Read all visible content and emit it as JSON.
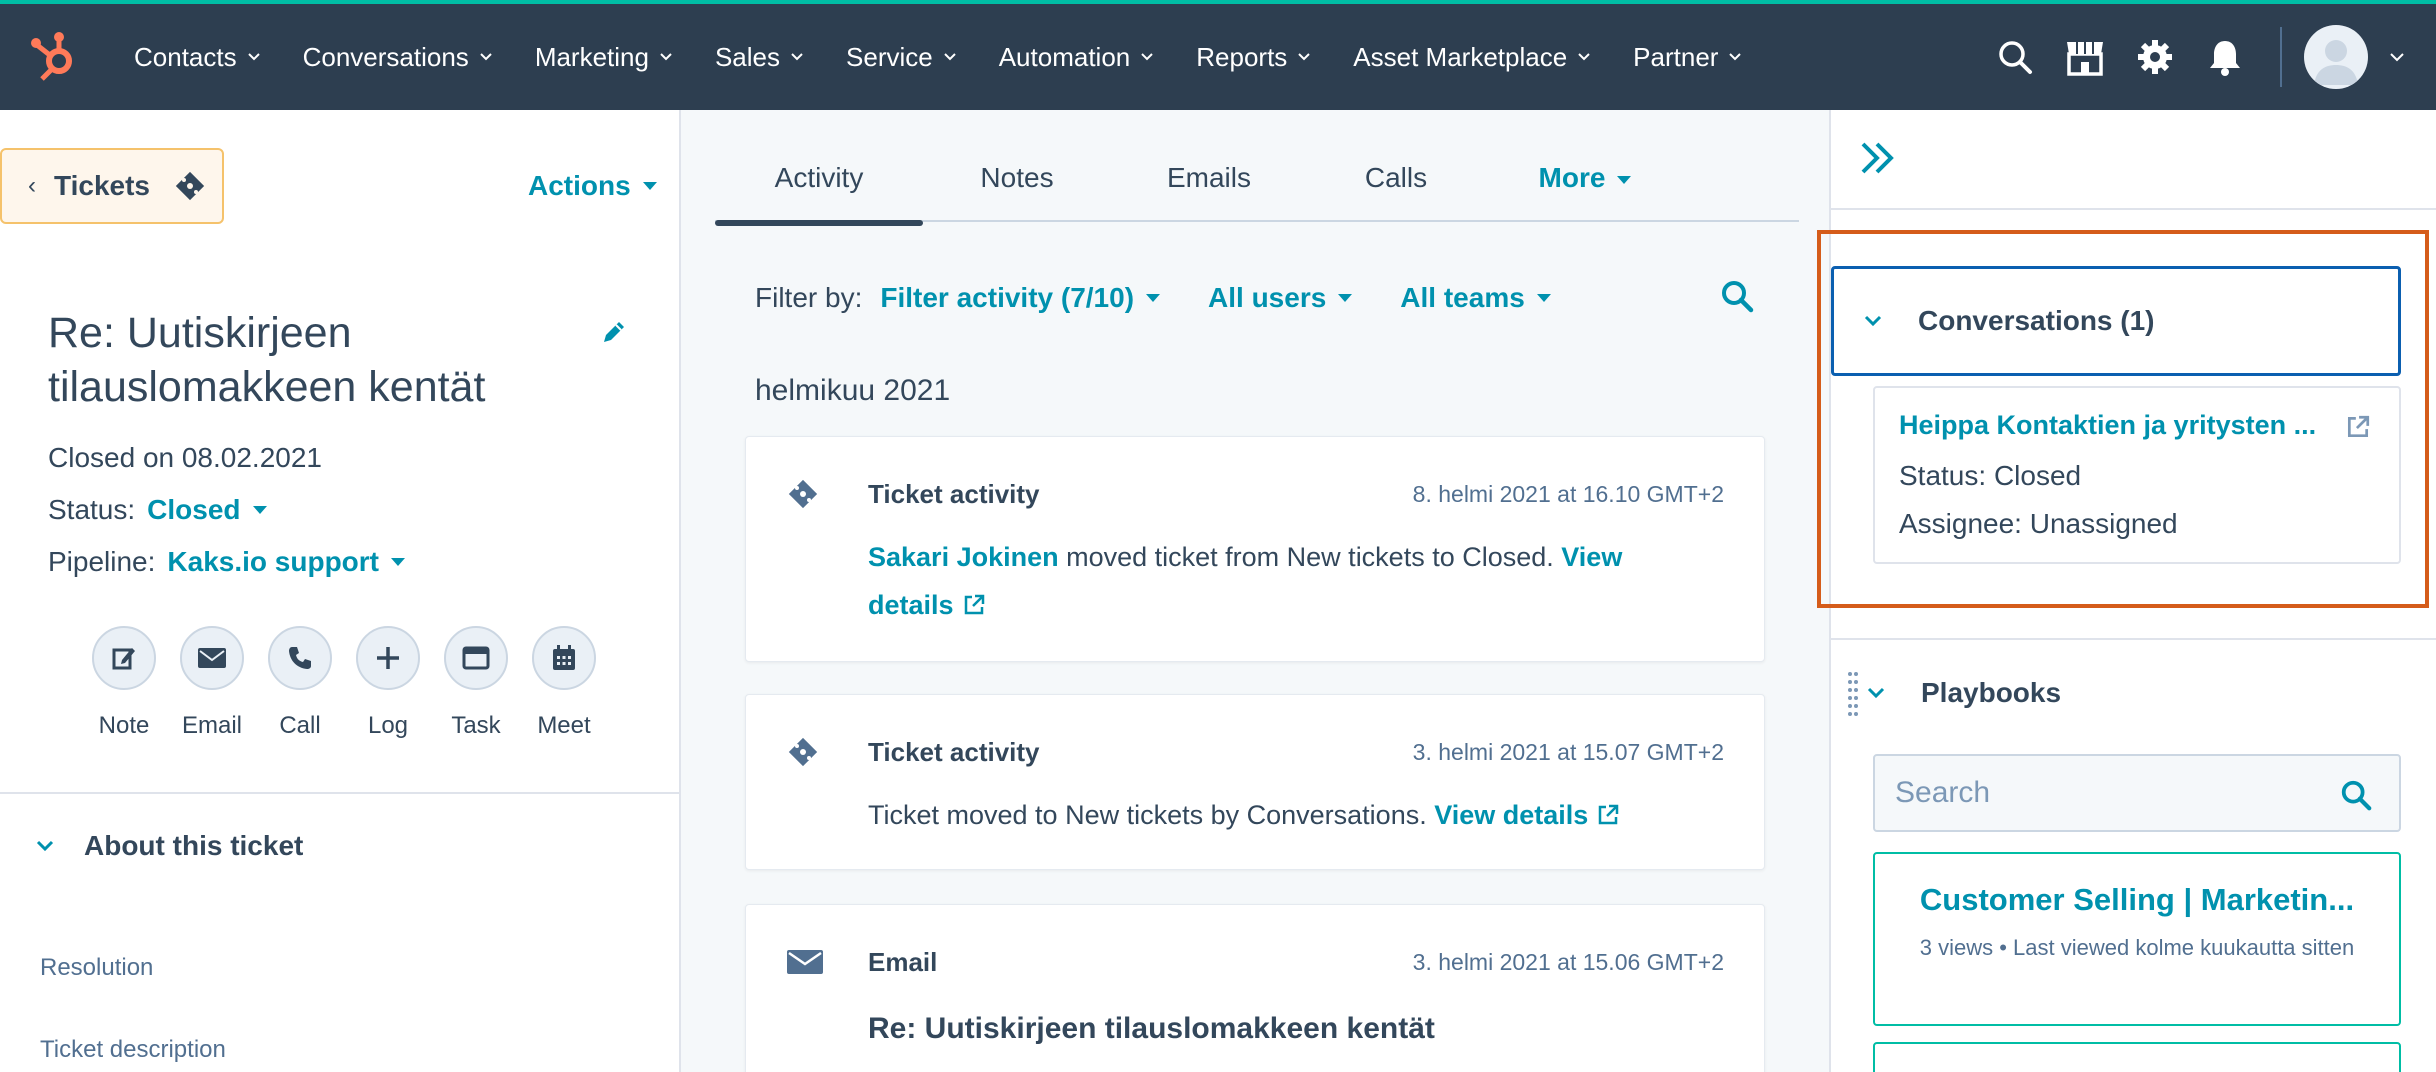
{
  "nav": {
    "items": [
      {
        "label": "Contacts"
      },
      {
        "label": "Conversations"
      },
      {
        "label": "Marketing"
      },
      {
        "label": "Sales"
      },
      {
        "label": "Service"
      },
      {
        "label": "Automation"
      },
      {
        "label": "Reports"
      },
      {
        "label": "Asset Marketplace"
      },
      {
        "label": "Partner"
      }
    ],
    "icons": [
      "search-icon",
      "marketplace-icon",
      "settings-gear-icon",
      "notifications-bell-icon",
      "avatar"
    ]
  },
  "left": {
    "back_label": "Tickets",
    "actions_label": "Actions",
    "title": "Re: Uutiskirjeen tilauslomakkeen kentät",
    "closed_on": "Closed on 08.02.2021",
    "status_label": "Status:",
    "status_value": "Closed",
    "pipeline_label": "Pipeline:",
    "pipeline_value": "Kaks.io support",
    "quick_actions": [
      {
        "label": "Note"
      },
      {
        "label": "Email"
      },
      {
        "label": "Call"
      },
      {
        "label": "Log"
      },
      {
        "label": "Task"
      },
      {
        "label": "Meet"
      }
    ],
    "about_label": "About this ticket",
    "fields": [
      "Resolution",
      "Ticket description"
    ]
  },
  "middle": {
    "tabs": [
      {
        "label": "Activity"
      },
      {
        "label": "Notes"
      },
      {
        "label": "Emails"
      },
      {
        "label": "Calls"
      },
      {
        "label": "More"
      }
    ],
    "filter_label": "Filter by:",
    "filter_activity": "Filter activity (7/10)",
    "filter_users": "All users",
    "filter_teams": "All teams",
    "month": "helmikuu 2021",
    "cards": [
      {
        "title": "Ticket activity",
        "date": "8. helmi 2021 at 16.10 GMT+2",
        "actor": "Sakari Jokinen",
        "text": " moved ticket from New tickets to Closed. ",
        "link": "View details"
      },
      {
        "title": "Ticket activity",
        "date": "3. helmi 2021 at 15.07 GMT+2",
        "text": "Ticket moved to New tickets by Conversations. ",
        "link": "View details"
      },
      {
        "title": "Email",
        "date": "3. helmi 2021 at 15.06 GMT+2",
        "subject": "Re: Uutiskirjeen tilauslomakkeen kentät"
      }
    ]
  },
  "right": {
    "conversations_header": "Conversations (1)",
    "conversation": {
      "link": "Heippa Kontaktien ja yritysten ...",
      "status": "Status: Closed",
      "assignee": "Assignee: Unassigned"
    },
    "playbooks_header": "Playbooks",
    "search_placeholder": "Search",
    "playbook": {
      "title": "Customer Selling | Marketin...",
      "meta": "3 views • Last viewed kolme kuukautta sitten"
    }
  },
  "colors": {
    "nav_bg": "#2d3e50",
    "accent_link": "#0091ae",
    "highlight_box": "#d55c1a",
    "teal_border": "#00bda5"
  }
}
